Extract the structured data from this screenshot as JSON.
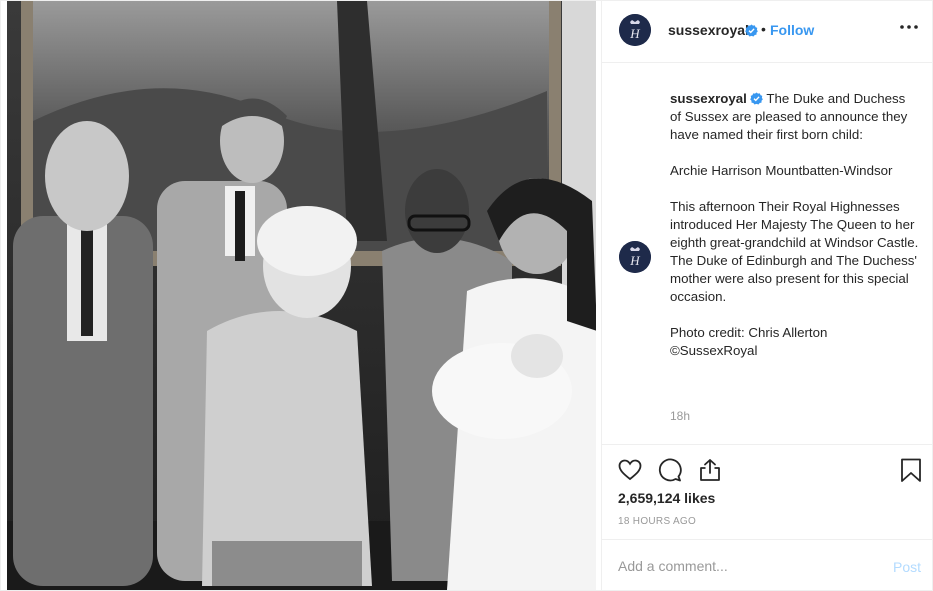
{
  "account": {
    "username": "sussexroyal",
    "verified_icon": "verified-badge-icon",
    "separator": "•",
    "follow_label": "Follow",
    "avatar_monogram": "H"
  },
  "caption": {
    "username": "sussexroyal",
    "intro": "The Duke and Duchess of Sussex are pleased to announce they have named their first born child:",
    "name": "Archie Harrison Mountbatten-Windsor",
    "body": "This afternoon Their Royal Highnesses introduced Her Majesty The Queen to her eighth great-grandchild at Windsor Castle. The Duke of Edinburgh and The Duchess' mother were also present for this special occasion.",
    "credit_line1": "Photo credit: Chris Allerton",
    "credit_line2": "©SussexRoyal",
    "time": "18h"
  },
  "actions": {
    "like_icon": "heart-icon",
    "comment_icon": "comment-icon",
    "share_icon": "share-icon",
    "save_icon": "bookmark-icon",
    "likes": "2,659,124 likes",
    "posted_ago": "18 HOURS AGO"
  },
  "comment": {
    "placeholder": "Add a comment...",
    "post_label": "Post"
  },
  "colors": {
    "link_blue": "#3897f0",
    "post_disabled": "#b3dbff",
    "avatar_navy": "#1e2a4a"
  }
}
